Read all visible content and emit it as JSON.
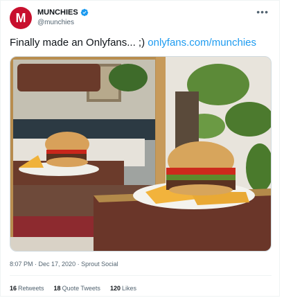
{
  "account": {
    "avatar_letter": "M",
    "display_name": "MUNCHIES",
    "handle": "@munchies",
    "verified": true,
    "avatar_color": "#c8102e"
  },
  "tweet": {
    "text": "Finally made an Onlyfans... ;)",
    "link": "onlyfans.com/munchies"
  },
  "meta": {
    "time": "8:07 PM",
    "separator1": " · ",
    "date": "Dec 17, 2020",
    "separator2": " · ",
    "source": "Sprout Social"
  },
  "stats": [
    {
      "count": "16",
      "label": "Retweets"
    },
    {
      "count": "18",
      "label": "Quote Tweets"
    },
    {
      "count": "120",
      "label": "Likes"
    }
  ],
  "colors": {
    "link": "#1d9bf0",
    "verified": "#1d9bf0",
    "muted": "#536471"
  },
  "icons": {
    "more": "more-options-icon",
    "verified": "verified-badge-icon"
  }
}
